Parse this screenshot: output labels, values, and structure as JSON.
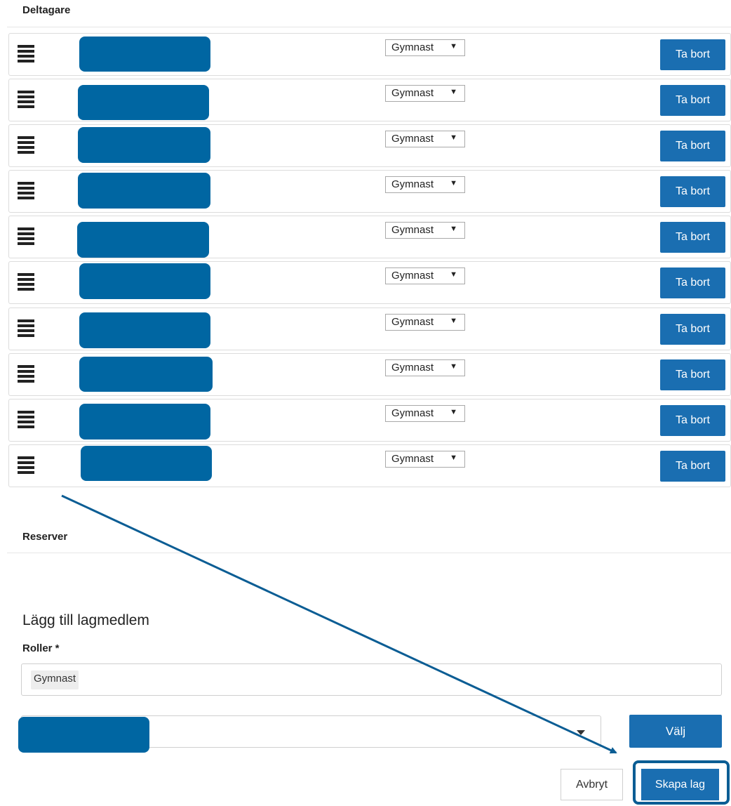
{
  "participants": {
    "heading": "Deltagare",
    "rows": [
      {
        "role": "Gymnast",
        "remove_label": "Ta bort"
      },
      {
        "role": "Gymnast",
        "remove_label": "Ta bort"
      },
      {
        "role": "Gymnast",
        "remove_label": "Ta bort"
      },
      {
        "role": "Gymnast",
        "remove_label": "Ta bort"
      },
      {
        "role": "Gymnast",
        "remove_label": "Ta bort"
      },
      {
        "role": "Gymnast",
        "remove_label": "Ta bort"
      },
      {
        "role": "Gymnast",
        "remove_label": "Ta bort"
      },
      {
        "role": "Gymnast",
        "remove_label": "Ta bort"
      },
      {
        "role": "Gymnast",
        "remove_label": "Ta bort"
      },
      {
        "role": "Gymnast",
        "remove_label": "Ta bort"
      }
    ]
  },
  "reserves": {
    "heading": "Reserver"
  },
  "add_member": {
    "heading": "Lägg till lagmedlem",
    "roles_label": "Roller *",
    "roles_selected": [
      "Gymnast"
    ],
    "choose_label": "Välj"
  },
  "footer": {
    "cancel_label": "Avbryt",
    "create_label": "Skapa lag"
  },
  "colors": {
    "accent": "#1a6eb1",
    "redaction": "#0066a2",
    "annotation": "#0b5d94"
  }
}
